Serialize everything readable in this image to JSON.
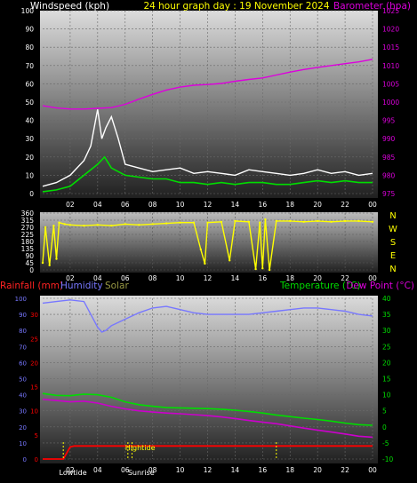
{
  "header": {
    "left_title": "Windspeed (kph)",
    "center_title": "24 hour graph day : 19 November 2024",
    "right_title": "Barometer (hpa)"
  },
  "colors": {
    "background": "#000000",
    "wind_gust": "#ffffff",
    "wind_avg": "#00dd00",
    "barometer": "#dd00dd",
    "direction": "#ffff00",
    "rainfall": "#ff0000",
    "humidity": "#7777ff",
    "solar": "#999944",
    "temperature": "#00dd00",
    "dew_point": "#cc00cc",
    "hightide_marker": "#ffff00"
  },
  "panel3_header": {
    "rainfall": "Rainfall (mm)",
    "humidity": "Humidity",
    "solar": "Solar",
    "temperature": "Temperature (°C)",
    "dew_point": "Dew Point (°C)"
  },
  "panel3_markers": {
    "lowtide": "Lowtide",
    "sunrise": "Sunrise",
    "hightide": "Hightide"
  },
  "chart_data": [
    {
      "type": "line",
      "x_ticks": [
        "02",
        "04",
        "06",
        "08",
        "10",
        "12",
        "14",
        "16",
        "18",
        "20",
        "22",
        "00"
      ],
      "ylim": [
        0,
        100
      ],
      "y_ticks": [
        "0",
        "10",
        "20",
        "30",
        "40",
        "50",
        "60",
        "70",
        "80",
        "90",
        "100"
      ],
      "y2lim": [
        975,
        1025
      ],
      "y2_ticks": [
        "975",
        "980",
        "985",
        "990",
        "995",
        "1000",
        "1005",
        "1010",
        "1015",
        "1020",
        "1025"
      ],
      "series": [
        {
          "x": [
            0,
            1,
            2,
            3,
            3.5,
            4,
            4.3,
            4.6,
            5,
            5.5,
            6,
            7,
            8,
            9,
            10,
            11,
            12,
            13,
            14,
            15,
            16,
            17,
            18,
            19,
            20,
            21,
            22,
            23,
            24
          ],
          "values": [
            4,
            6,
            10,
            18,
            26,
            46,
            30,
            36,
            42,
            30,
            16,
            14,
            12,
            13,
            14,
            11,
            12,
            11,
            10,
            13,
            12,
            11,
            10,
            11,
            13,
            11,
            12,
            10,
            11
          ]
        },
        {
          "x": [
            0,
            1,
            2,
            3,
            4,
            4.5,
            5,
            6,
            7,
            8,
            9,
            10,
            11,
            12,
            13,
            14,
            15,
            16,
            17,
            18,
            19,
            20,
            21,
            22,
            23,
            24
          ],
          "values": [
            1,
            2,
            4,
            10,
            16,
            20,
            14,
            10,
            9,
            8,
            8,
            6,
            6,
            5,
            6,
            5,
            6,
            6,
            5,
            5,
            6,
            7,
            6,
            7,
            6,
            6
          ]
        },
        {
          "x": [
            0,
            1,
            2,
            3,
            4,
            5,
            6,
            7,
            8,
            9,
            10,
            11,
            12,
            13,
            14,
            15,
            16,
            17,
            18,
            19,
            20,
            21,
            22,
            23,
            24
          ],
          "values": [
            999,
            998.4,
            998.1,
            998.1,
            998.3,
            998.5,
            999.4,
            1000.8,
            1002.1,
            1003.3,
            1004.1,
            1004.6,
            1004.8,
            1005.1,
            1005.7,
            1006.2,
            1006.6,
            1007.4,
            1008.2,
            1008.9,
            1009.5,
            1010.0,
            1010.5,
            1011.0,
            1011.7
          ]
        }
      ]
    },
    {
      "type": "scatter",
      "x_ticks": [
        "02",
        "04",
        "06",
        "08",
        "10",
        "12",
        "14",
        "16",
        "18",
        "20",
        "22",
        "00"
      ],
      "ylim": [
        0,
        360
      ],
      "y_ticks": [
        "0",
        "45",
        "90",
        "135",
        "180",
        "225",
        "270",
        "315",
        "360"
      ],
      "y2_ticks": [
        "N",
        "W",
        "S",
        "E",
        "N"
      ],
      "series": [
        {
          "x": [
            0,
            0.2,
            0.5,
            0.8,
            1,
            1.2,
            1.6,
            2,
            3,
            4,
            5,
            6,
            7,
            8,
            9,
            10,
            11,
            11.5,
            11.8,
            12,
            13,
            13.6,
            14,
            15,
            15.5,
            15.8,
            16,
            16.2,
            16.5,
            17,
            18,
            19,
            20,
            21,
            22,
            23,
            24
          ],
          "values": [
            45,
            270,
            30,
            280,
            70,
            300,
            290,
            285,
            280,
            285,
            280,
            290,
            285,
            290,
            295,
            300,
            300,
            130,
            40,
            300,
            305,
            60,
            310,
            305,
            5,
            300,
            10,
            320,
            0,
            310,
            310,
            305,
            310,
            305,
            310,
            310,
            305
          ]
        }
      ]
    },
    {
      "type": "line",
      "x_ticks": [
        "02",
        "04",
        "06",
        "08",
        "10",
        "12",
        "14",
        "16",
        "18",
        "20",
        "22",
        "00"
      ],
      "ylim": [
        0,
        100
      ],
      "y_ticks": [
        "0",
        "10",
        "20",
        "30",
        "40",
        "50",
        "60",
        "70",
        "80",
        "90",
        "100"
      ],
      "y_left_ticks_rain": [
        "0",
        "5",
        "10",
        "15",
        "20",
        "25",
        "30"
      ],
      "y2lim": [
        -10,
        40
      ],
      "y2_ticks": [
        "-10",
        "-5",
        "0",
        "5",
        "10",
        "15",
        "20",
        "25",
        "30",
        "35",
        "40"
      ],
      "series": [
        {
          "x": [
            0,
            1,
            1.5,
            2,
            2.3,
            24
          ],
          "values": [
            0,
            0,
            0,
            2.5,
            2.7,
            2.7
          ]
        },
        {
          "x": [
            0,
            1,
            2,
            3,
            3.5,
            4,
            4.3,
            4.6,
            5,
            6,
            7,
            8,
            9,
            10,
            11,
            12,
            13,
            14,
            15,
            16,
            17,
            18,
            19,
            20,
            21,
            22,
            23,
            24
          ],
          "values": [
            97,
            98,
            99,
            98,
            90,
            82,
            79,
            80,
            83,
            87,
            91,
            94,
            95,
            93,
            91,
            90,
            90,
            90,
            90,
            91,
            92,
            93,
            94,
            94,
            93,
            92,
            90,
            89
          ]
        },
        {
          "x": [
            0,
            1,
            2,
            3,
            4,
            5,
            6,
            7,
            8,
            9,
            10,
            11,
            12,
            13,
            14,
            15,
            16,
            17,
            18,
            19,
            20,
            21,
            22,
            23,
            24
          ],
          "values": [
            10.4,
            9.8,
            9.7,
            10.2,
            10.0,
            9.2,
            7.8,
            6.9,
            6.4,
            6.0,
            5.9,
            5.8,
            5.7,
            5.5,
            5.2,
            4.8,
            4.3,
            3.7,
            3.2,
            2.7,
            2.3,
            1.8,
            1.2,
            0.7,
            0.5
          ]
        },
        {
          "x": [
            0,
            1,
            2,
            3,
            4,
            5,
            6,
            7,
            8,
            9,
            10,
            11,
            12,
            13,
            14,
            15,
            16,
            17,
            18,
            19,
            20,
            21,
            22,
            23,
            24
          ],
          "values": [
            8.6,
            8.2,
            7.8,
            8.0,
            7.4,
            6.4,
            5.6,
            5.0,
            4.6,
            4.3,
            4.1,
            3.8,
            3.5,
            3.1,
            2.6,
            2.0,
            1.5,
            1.0,
            0.3,
            -0.4,
            -1.0,
            -1.6,
            -2.2,
            -2.9,
            -3.2
          ]
        }
      ],
      "markers": [
        {
          "x": 1.5
        },
        {
          "x": 6.2
        },
        {
          "x": 6.5
        },
        {
          "x": 17.0
        }
      ]
    }
  ]
}
